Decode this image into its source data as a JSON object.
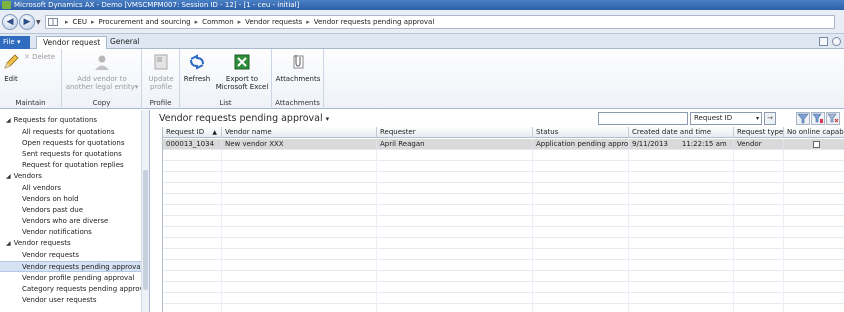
{
  "window": {
    "title": "Microsoft Dynamics AX - Demo [VMSCMPM007: Session ID - 12] - [1 - ceu - initial]"
  },
  "address": {
    "crumbs": [
      "CEU",
      "Procurement and sourcing",
      "Common",
      "Vendor requests",
      "Vendor requests pending approval"
    ]
  },
  "ribbon": {
    "file_label": "File",
    "tabs": [
      "Vendor request",
      "General"
    ],
    "groups": {
      "maintain": {
        "label": "Maintain",
        "edit": "Edit",
        "delete": "Delete"
      },
      "copy": {
        "label": "Copy",
        "add_vendor_line1": "Add vendor to",
        "add_vendor_line2": "another legal entity"
      },
      "profile": {
        "label": "Profile",
        "update_line1": "Update",
        "update_line2": "profile"
      },
      "list": {
        "label": "List",
        "refresh": "Refresh",
        "export_line1": "Export to",
        "export_line2": "Microsoft Excel"
      },
      "attachments": {
        "label": "Attachments",
        "attachments_btn": "Attachments"
      }
    }
  },
  "nav": {
    "sections": [
      {
        "title": "Requests for quotations",
        "items": [
          "All requests for quotations",
          "Open requests for quotations",
          "Sent requests for quotations",
          "Request for quotation replies"
        ]
      },
      {
        "title": "Vendors",
        "items": [
          "All vendors",
          "Vendors on hold",
          "Vendors past due",
          "Vendors who are diverse",
          "Vendor notifications"
        ]
      },
      {
        "title": "Vendor requests",
        "items": [
          "Vendor requests",
          "Vendor requests pending approval",
          "Vendor profile pending approval",
          "Category requests pending approval",
          "Vendor user requests"
        ]
      }
    ]
  },
  "list": {
    "title": "Vendor requests pending approval",
    "filter_field": "Request ID",
    "filter_value": "",
    "columns": [
      "Request ID",
      "Vendor name",
      "Requester",
      "Status",
      "Created date and time",
      "Request type",
      "No online capabilit"
    ],
    "rows": [
      {
        "request_id": "000013_1034",
        "vendor_name": "New vendor XXX",
        "requester": "April Reagan",
        "status": "Application pending approval",
        "created_date": "9/11/2013",
        "created_time": "11:22:15 am",
        "request_type": "Vendor",
        "no_online": false
      }
    ]
  },
  "colors": {
    "titlebar": "#2d5fa7",
    "file_tab": "#2f6cc0",
    "selected_nav": "#d6e3f5",
    "selected_row": "#d9d9d9"
  }
}
